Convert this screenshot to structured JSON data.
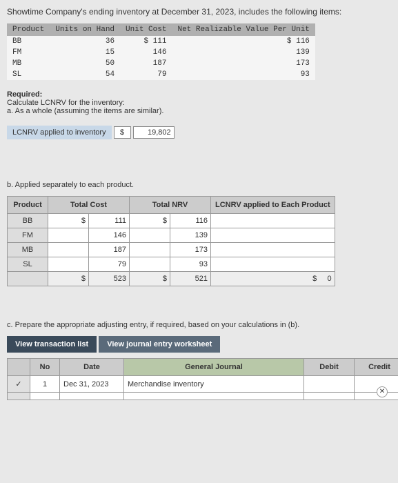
{
  "intro": "Showtime Company's ending inventory at December 31, 2023, includes the following items:",
  "table1": {
    "headers": [
      "Product",
      "Units on Hand",
      "Unit Cost",
      "Net Realizable Value Per Unit"
    ],
    "rows": [
      [
        "BB",
        "36",
        "$ 111",
        "$ 116"
      ],
      [
        "FM",
        "15",
        "146",
        "139"
      ],
      [
        "MB",
        "50",
        "187",
        "173"
      ],
      [
        "SL",
        "54",
        "79",
        "93"
      ]
    ]
  },
  "required": "Required:",
  "req_text": "Calculate LCNRV for the inventory:",
  "part_a": "a. As a whole (assuming the items are similar).",
  "lcnrv_label": "LCNRV applied to inventory",
  "lcnrv_sym": "$",
  "lcnrv_val": "19,802",
  "part_b": "b. Applied separately to each product.",
  "table2": {
    "headers": [
      "Product",
      "Total Cost",
      "Total NRV",
      "LCNRV applied to Each Product"
    ],
    "rows": [
      [
        "BB",
        "$",
        "111",
        "$",
        "116",
        ""
      ],
      [
        "FM",
        "",
        "146",
        "",
        "139",
        ""
      ],
      [
        "MB",
        "",
        "187",
        "",
        "173",
        ""
      ],
      [
        "SL",
        "",
        "79",
        "",
        "93",
        ""
      ]
    ],
    "total": [
      "",
      "$",
      "523",
      "$",
      "521",
      "$",
      "0"
    ]
  },
  "part_c": "c. Prepare the appropriate adjusting entry, if required, based on your calculations in (b).",
  "tabs": {
    "active": "View transaction list",
    "inactive": "View journal entry worksheet"
  },
  "je": {
    "headers": [
      "No",
      "Date",
      "General Journal",
      "Debit",
      "Credit"
    ],
    "row": [
      "1",
      "Dec 31, 2023",
      "Merchandise inventory",
      "",
      ""
    ]
  },
  "check": "✓",
  "close": "✕"
}
